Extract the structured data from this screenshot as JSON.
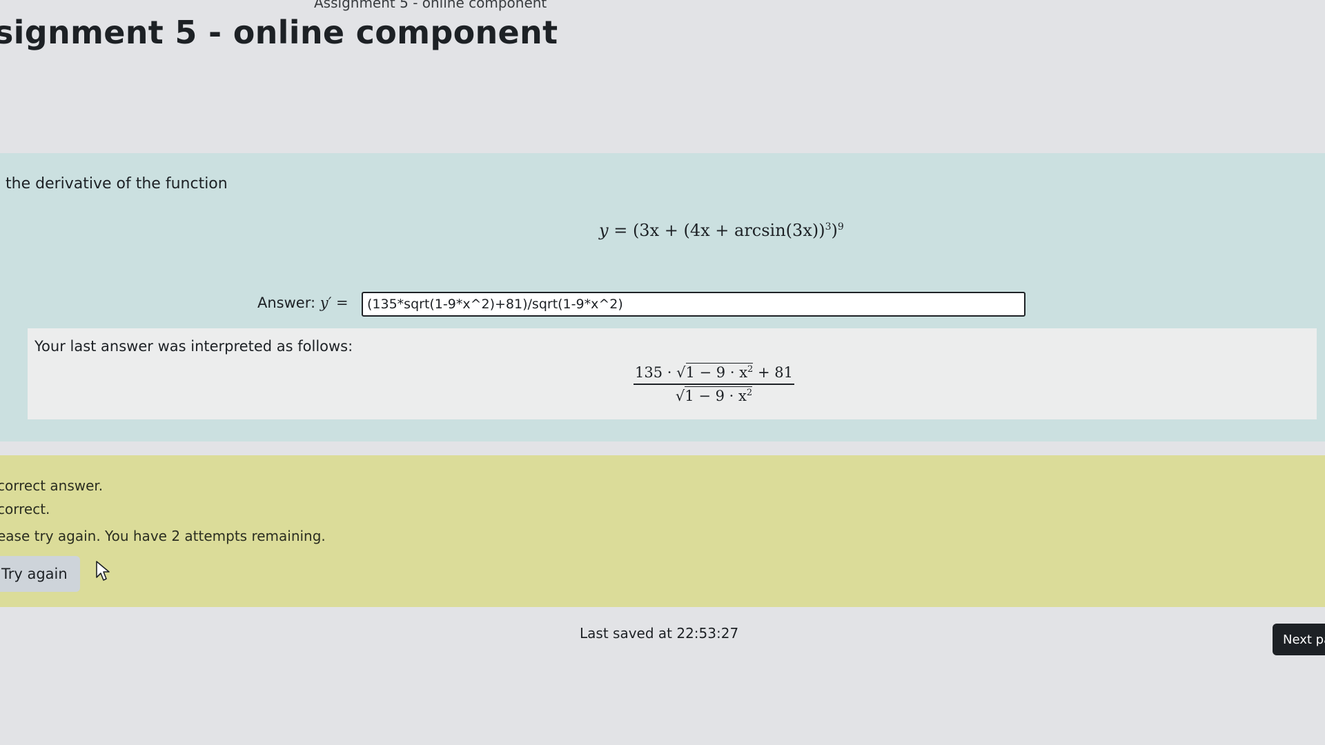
{
  "header": {
    "breadcrumb": "Assignment 5 - online component",
    "title": "signment 5 - online component"
  },
  "question": {
    "prompt": "the derivative of the function",
    "formula": {
      "lhs": "y = ",
      "body": "(3x + (4x + arcsin(3x))",
      "inner_exp": "3",
      "close": ")",
      "outer_exp": "9"
    },
    "answer_label": "Answer: ",
    "answer_symbol": "y′ =",
    "answer_value": "(135*sqrt(1-9*x^2)+81)/sqrt(1-9*x^2)"
  },
  "interpretation": {
    "label": "Your last answer was interpreted as follows:",
    "numerator_pre": "135 · √",
    "numerator_rad": "1 − 9 · x",
    "numerator_exp": "2",
    "numerator_post": " + 81",
    "denominator_pre": "√",
    "denominator_rad": "1 − 9 · x",
    "denominator_exp": "2"
  },
  "feedback": {
    "line1": "correct answer.",
    "line2": "correct.",
    "line3": "ease try again. You have 2 attempts remaining.",
    "try_again_label": "Try again"
  },
  "footer": {
    "last_saved": "Last saved at 22:53:27",
    "next_page_label": "Next pa"
  },
  "icons": {
    "cursor": "mouse-pointer-icon"
  }
}
